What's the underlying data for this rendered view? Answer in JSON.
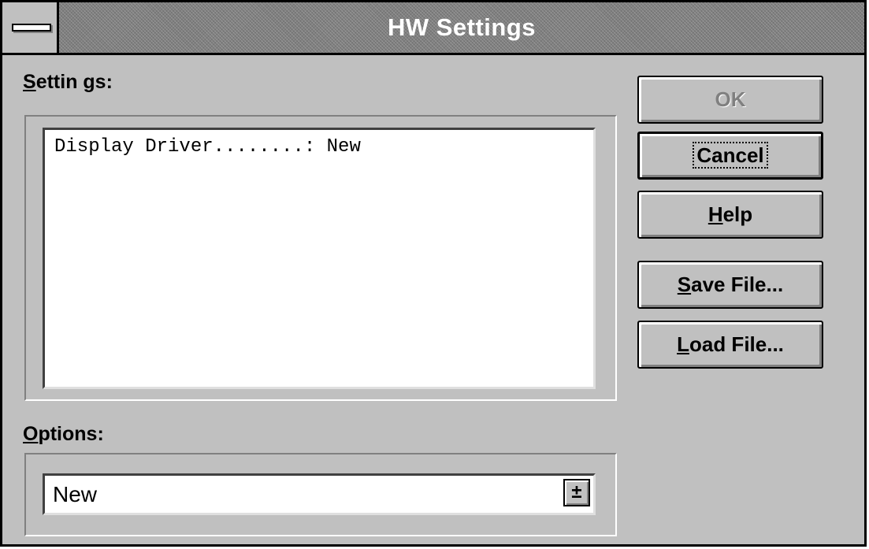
{
  "window": {
    "title": "HW Settings",
    "system_menu_icon": "minus-bar-icon"
  },
  "settings": {
    "label_mnemonic": "S",
    "label_rest": "ettin gs:",
    "list_items": [
      "Display Driver........: New"
    ]
  },
  "options": {
    "label_mnemonic": "O",
    "label_rest": "ptions:",
    "selected_value": "New",
    "arrow_icon": "down-arrow-icon",
    "arrow_glyph": "±"
  },
  "buttons": {
    "ok": "OK",
    "cancel": "Cancel",
    "help_mnemonic": "H",
    "help_rest": "elp",
    "save_mnemonic": "S",
    "save_rest": "ave File...",
    "load_mnemonic": "L",
    "load_rest": "oad File..."
  }
}
